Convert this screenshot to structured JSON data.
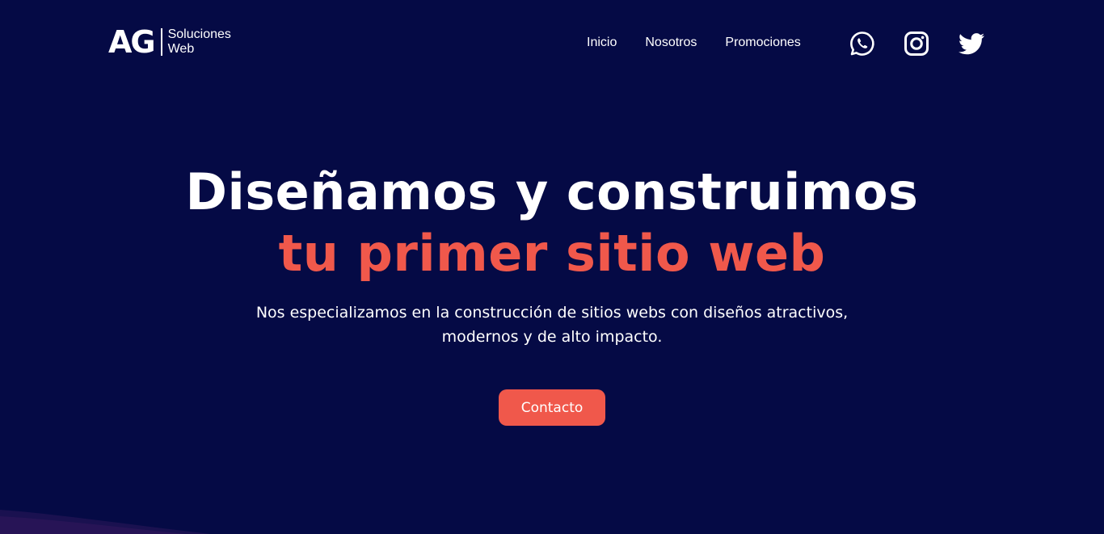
{
  "brand": {
    "mark": "AG",
    "line1": "Soluciones",
    "line2": "Web"
  },
  "nav": {
    "items": [
      {
        "label": "Inicio"
      },
      {
        "label": "Nosotros"
      },
      {
        "label": "Promociones"
      }
    ]
  },
  "socials": [
    {
      "icon": "whatsapp-icon"
    },
    {
      "icon": "instagram-icon"
    },
    {
      "icon": "twitter-icon"
    }
  ],
  "hero": {
    "title_line1": "Diseñamos y construimos",
    "title_line2": "tu primer sitio web",
    "subtitle": "Nos especializamos en la construcción de sitios webs con diseños atractivos, modernos y de alto impacto.",
    "cta_label": "Contacto"
  },
  "colors": {
    "background": "#050a45",
    "accent": "#f0584b",
    "text": "#ffffff"
  }
}
